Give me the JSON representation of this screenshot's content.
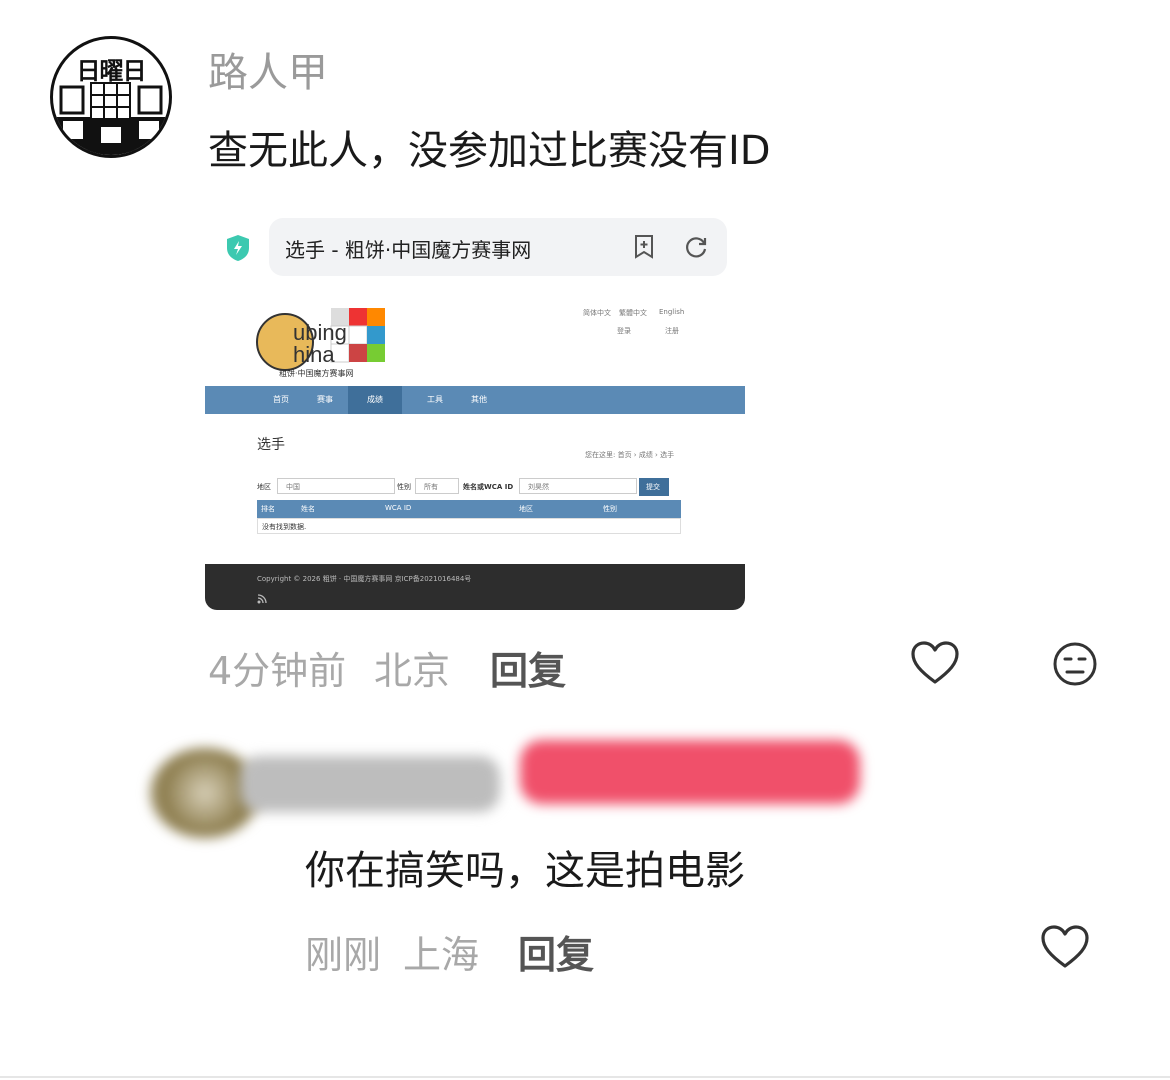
{
  "comment1": {
    "avatar_text": "日曜日",
    "author": "路人甲",
    "text": "查无此人，没参加过比赛没有ID",
    "time": "4分钟前",
    "location": "北京",
    "reply_label": "回复",
    "icons": [
      "heart-icon",
      "neutral-face-icon"
    ]
  },
  "embedded_screenshot": {
    "browser_title": "选手 - 粗饼·中国魔方赛事网",
    "site": {
      "logo_caption": "粗饼·中国魔方赛事网",
      "lang_links": [
        "简体中文",
        "繁體中文",
        "English"
      ],
      "login": "登录",
      "register": "注册",
      "nav": [
        "首页",
        "赛事",
        "成绩",
        "工具",
        "其他"
      ],
      "page_title": "选手",
      "breadcrumb": "您在这里: 首页 › 成绩 › 选手",
      "filter": {
        "region_label": "地区",
        "region_value": "中国",
        "gender_label": "性别",
        "gender_value": "所有",
        "name_label": "姓名或WCA ID",
        "name_value": "刘昊然",
        "submit": "提交"
      },
      "table_headers": [
        "排名",
        "姓名",
        "WCA ID",
        "地区",
        "性别"
      ],
      "empty_message": "没有找到数据.",
      "footer": "Copyright © 2026 粗饼 · 中国魔方赛事网 京ICP备2021016484号"
    }
  },
  "comment2": {
    "text": "你在搞笑吗，这是拍电影",
    "time": "刚刚",
    "location": "上海",
    "reply_label": "回复",
    "icons": [
      "heart-icon"
    ]
  },
  "colors": {
    "nav_blue": "#5b8ab5",
    "muted_text": "#a8a8a8",
    "redaction_pink": "#f0506a"
  }
}
